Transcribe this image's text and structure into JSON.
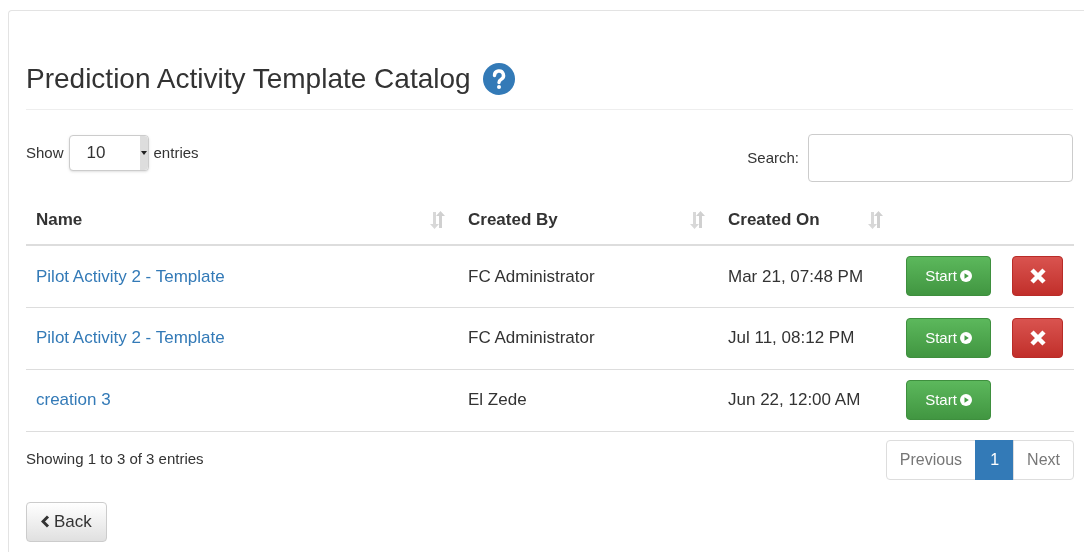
{
  "title": "Prediction Activity Template Catalog",
  "length_menu": {
    "before": "Show",
    "value": "10",
    "after": "entries"
  },
  "search": {
    "label": "Search:"
  },
  "table": {
    "columns": [
      "Name",
      "Created By",
      "Created On"
    ],
    "rows": [
      {
        "name": "Pilot Activity 2 - Template",
        "created_by": "FC Administrator",
        "created_on": "Mar 21, 07:48 PM",
        "start": "Start",
        "deletable": true
      },
      {
        "name": "Pilot Activity 2 - Template",
        "created_by": "FC Administrator",
        "created_on": "Jul 11, 08:12 PM",
        "start": "Start",
        "deletable": true
      },
      {
        "name": "creation 3",
        "created_by": "El Zede",
        "created_on": "Jun 22, 12:00 AM",
        "start": "Start",
        "deletable": false
      }
    ]
  },
  "info": "Showing 1 to 3 of 3 entries",
  "pagination": [
    {
      "label": "Previous",
      "selected": false
    },
    {
      "label": "1",
      "selected": true
    },
    {
      "label": "Next",
      "selected": false
    }
  ],
  "back_button": "Back"
}
